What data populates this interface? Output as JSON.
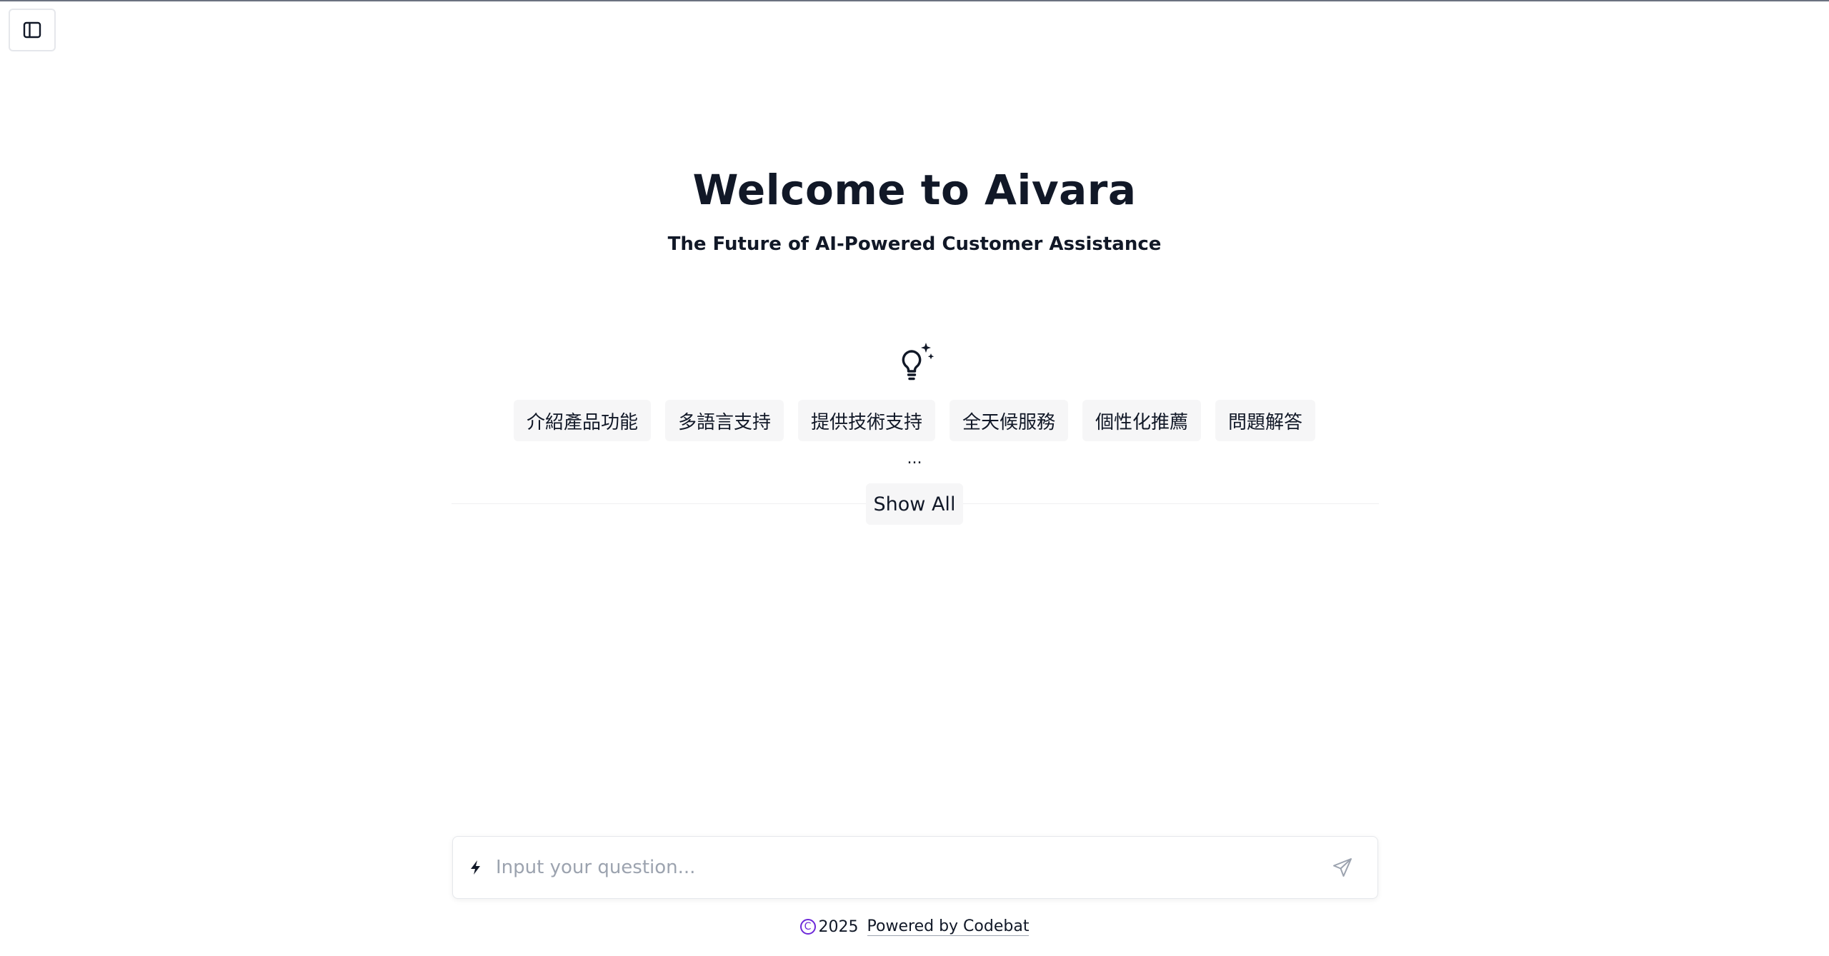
{
  "sidebar": {
    "toggle_icon": "sidebar-panel-icon"
  },
  "hero": {
    "title": "Welcome to Aivara",
    "subtitle": "The Future of AI-Powered Customer Assistance",
    "icon": "lightbulb-sparkle-icon"
  },
  "suggestions": {
    "items": [
      {
        "label": "介紹產品功能"
      },
      {
        "label": "多語言支持"
      },
      {
        "label": "提供技術支持"
      },
      {
        "label": "全天候服務"
      },
      {
        "label": "個性化推薦"
      },
      {
        "label": "問題解答"
      }
    ],
    "ellipsis": "...",
    "show_all_label": "Show All"
  },
  "input": {
    "placeholder": "Input your question...",
    "value": "",
    "leading_icon": "bolt-icon",
    "send_icon": "send-icon"
  },
  "footer": {
    "copyright_symbol": "C",
    "year": "2025",
    "powered_by": "Powered by Codebat"
  },
  "colors": {
    "text": "#111827",
    "chip_bg": "#f6f6f7",
    "placeholder": "#9ca3af",
    "accent": "#6d28d9"
  }
}
